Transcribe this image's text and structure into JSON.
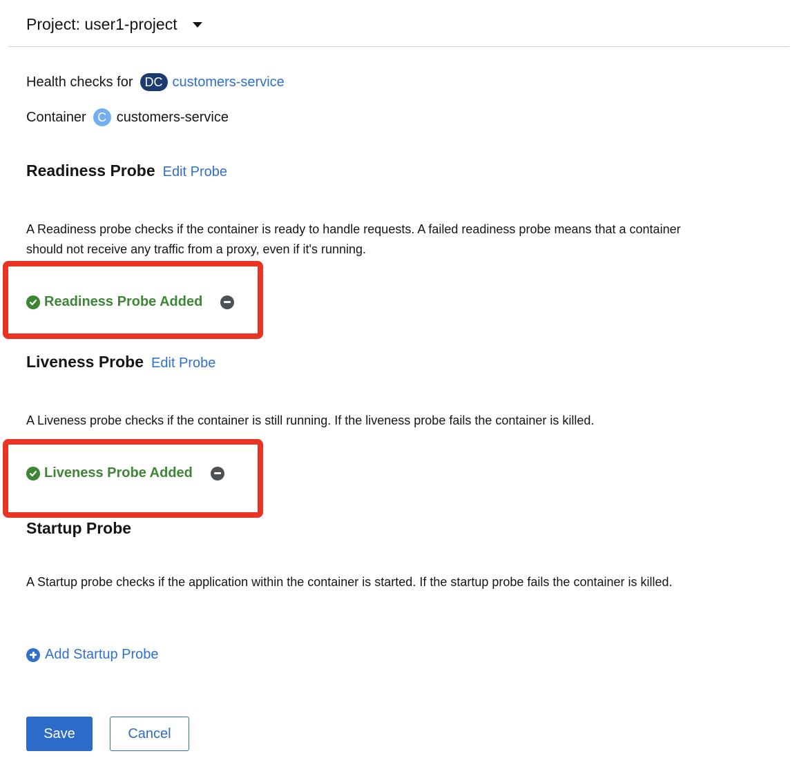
{
  "project": {
    "label": "Project: user1-project"
  },
  "health_checks": {
    "prefix": "Health checks for",
    "resource_badge": "DC",
    "resource_name": "customers-service"
  },
  "container": {
    "label": "Container",
    "badge": "C",
    "name": "customers-service"
  },
  "readiness": {
    "title": "Readiness Probe",
    "edit_label": "Edit Probe",
    "description": "A Readiness probe checks if the container is ready to handle requests. A failed readiness probe means that a container should not receive any traffic from a proxy, even if it's running.",
    "status": "Readiness Probe Added"
  },
  "liveness": {
    "title": "Liveness Probe",
    "edit_label": "Edit Probe",
    "description": "A Liveness probe checks if the container is still running. If the liveness probe fails the container is killed.",
    "status": "Liveness Probe Added"
  },
  "startup": {
    "title": "Startup Probe",
    "description": "A Startup probe checks if the application within the container is started. If the startup probe fails the container is killed.",
    "add_label": "Add Startup Probe"
  },
  "actions": {
    "save_label": "Save",
    "cancel_label": "Cancel"
  },
  "colors": {
    "link": "#2f6fce",
    "success": "#3e8635",
    "highlight": "#ea3323",
    "dc_badge": "#1c3c70",
    "c_badge": "#73aef0"
  },
  "icons": {
    "project_dropdown": "caret-down-icon",
    "status_ok": "check-circle-icon",
    "remove": "minus-circle-icon",
    "add": "plus-circle-icon"
  }
}
